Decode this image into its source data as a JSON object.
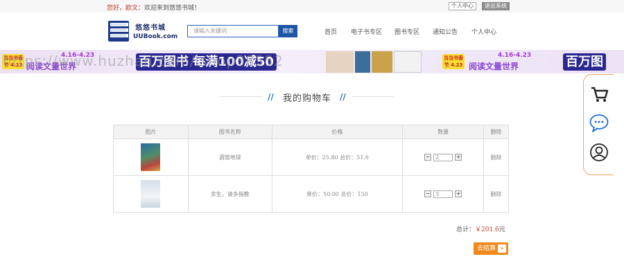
{
  "topbar": {
    "greeting_prefix": "您好，欧文：",
    "greeting_rest": "欢迎来到悠悠书城！",
    "personal_center": "个人中心",
    "logout": "退出系统"
  },
  "logo": {
    "title": "悠悠书城",
    "subtitle": "UUBook.com"
  },
  "search": {
    "placeholder": "请输入关键词",
    "button": "搜索"
  },
  "nav": [
    "首页",
    "电子书专区",
    "图书专区",
    "通知公告",
    "个人中心"
  ],
  "banner": {
    "tag": "当当书香节 4.23",
    "date": "4.16-4.23",
    "slogan": "阅读文量世界",
    "headline": "百万图书 每满100减50",
    "headline_right": "百万图",
    "watermark": "https://www.huzhan.com/ishop38552"
  },
  "page_title": "我的购物车",
  "cart": {
    "columns": [
      "图片",
      "图书名称",
      "价格",
      "数量",
      "删除"
    ],
    "rows": [
      {
        "name": "酒馆地球",
        "price": "单价：25.80 总价：51.6",
        "qty": "2",
        "delete": "删除",
        "cover": "#2f5f86"
      },
      {
        "name": "余生，请多指教",
        "price": "单价：50.00 总价：150",
        "qty": "3",
        "delete": "删除",
        "cover": "#e8eef3"
      }
    ]
  },
  "total": {
    "label": "总计：",
    "amount": "￥201.6",
    "unit": "元"
  },
  "checkout": {
    "label": "去结算"
  },
  "colors": {
    "accent_blue": "#1c55a6",
    "orange": "#f08a1c",
    "price_red": "#c0392b"
  }
}
